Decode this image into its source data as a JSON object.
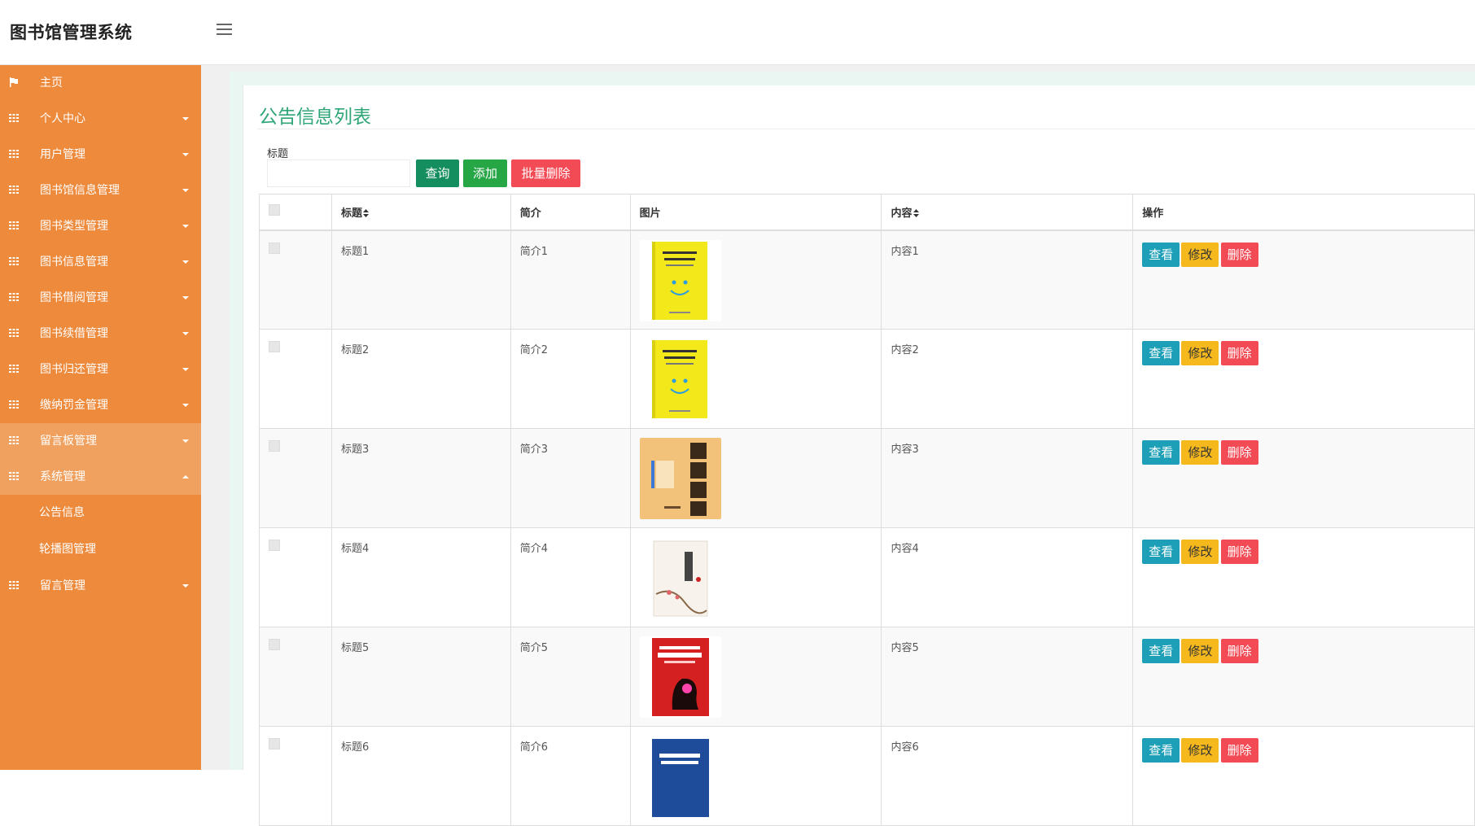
{
  "app": {
    "title": "图书馆管理系统"
  },
  "sidebar": {
    "home": "主页",
    "items": [
      {
        "label": "个人中心"
      },
      {
        "label": "用户管理"
      },
      {
        "label": "图书馆信息管理"
      },
      {
        "label": "图书类型管理"
      },
      {
        "label": "图书信息管理"
      },
      {
        "label": "图书借阅管理"
      },
      {
        "label": "图书续借管理"
      },
      {
        "label": "图书归还管理"
      },
      {
        "label": "缴纳罚金管理"
      },
      {
        "label": "留言板管理"
      },
      {
        "label": "系统管理"
      }
    ],
    "sub_items": [
      "公告信息",
      "轮播图管理"
    ],
    "last_item": "留言管理"
  },
  "panel": {
    "title": "公告信息列表"
  },
  "search": {
    "label": "标题",
    "value": "",
    "placeholder": ""
  },
  "buttons": {
    "query": "查询",
    "add": "添加",
    "batch_delete": "批量删除"
  },
  "table": {
    "headers": [
      "标题",
      "简介",
      "图片",
      "内容",
      "操作"
    ],
    "rows": [
      {
        "title": "标题1",
        "intro": "简介1",
        "content": "内容1",
        "cover": "book-cover-yellow"
      },
      {
        "title": "标题2",
        "intro": "简介2",
        "content": "内容2",
        "cover": "book-cover-yellow"
      },
      {
        "title": "标题3",
        "intro": "简介3",
        "content": "内容3",
        "cover": "book-cover-chinese-philosophy"
      },
      {
        "title": "标题4",
        "intro": "简介4",
        "content": "内容4",
        "cover": "book-cover-white"
      },
      {
        "title": "标题5",
        "intro": "简介5",
        "content": "内容5",
        "cover": "book-cover-red"
      },
      {
        "title": "标题6",
        "intro": "简介6",
        "content": "内容6",
        "cover": "book-cover-blue"
      }
    ],
    "actions": {
      "view": "查看",
      "edit": "修改",
      "delete": "删除"
    }
  },
  "colors": {
    "sidebar": "#ed8a3c",
    "accent": "#2fa677",
    "view": "#1c9fb7",
    "edit": "#f5b81d",
    "delete": "#f34b55"
  }
}
